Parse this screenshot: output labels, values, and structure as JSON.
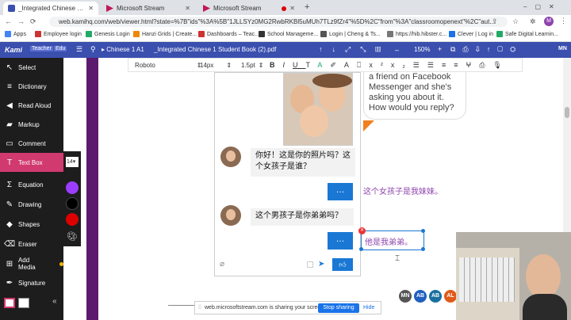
{
  "tabs": [
    {
      "title": "_Integrated Chinese 1 Student B",
      "active": true
    },
    {
      "title": "Microsoft Stream",
      "active": false
    },
    {
      "title": "Microsoft Stream",
      "active": false
    }
  ],
  "new_tab": "+",
  "address": {
    "url": "web.kamihq.com/web/viewer.html?state=%7B\"ids\"%3A%5B\"1JLLSYz0MG2RwbRKBl5uMUh7TLz9fZr4\"%5D%2C\"from\"%3A\"classroomopenext\"%2C\"aut..."
  },
  "profile_initial": "M",
  "bookmarks": [
    {
      "label": "Apps",
      "color": "#4285f4"
    },
    {
      "label": "Employee login",
      "color": "#c33"
    },
    {
      "label": "Genesis Login",
      "color": "#2a6"
    },
    {
      "label": "Hanzi Grids | Create...",
      "color": "#e80"
    },
    {
      "label": "Dashboards – Teac...",
      "color": "#c33"
    },
    {
      "label": "School Manageme...",
      "color": "#333"
    },
    {
      "label": "Login | Cheng & Ts...",
      "color": "#555"
    },
    {
      "label": "https://hib.hibster.c...",
      "color": "#777"
    },
    {
      "label": "Clever | Log in",
      "color": "#1a73e8"
    },
    {
      "label": "Safe Digital Learnin...",
      "color": "#2a6"
    }
  ],
  "kami": {
    "logo": "Kami",
    "role1": "Teacher",
    "role2": "Edu",
    "doc_breadcrumb": "Chinese 1 A1",
    "doc_name": "_Integrated Chinese 1 Student Book (2).pdf",
    "zoom": "150%",
    "avatar": "MN"
  },
  "tools": [
    {
      "label": "Select",
      "icon": "↖"
    },
    {
      "label": "Dictionary",
      "icon": "≡"
    },
    {
      "label": "Read Aloud",
      "icon": "◀"
    },
    {
      "label": "Markup",
      "icon": "▰"
    },
    {
      "label": "Comment",
      "icon": "▭"
    },
    {
      "label": "Text Box",
      "icon": "T"
    },
    {
      "label": "Equation",
      "icon": "Σ"
    },
    {
      "label": "Drawing",
      "icon": "✎"
    },
    {
      "label": "Shapes",
      "icon": "◆"
    },
    {
      "label": "Eraser",
      "icon": "⌫"
    },
    {
      "label": "Add Media",
      "icon": "⊞"
    },
    {
      "label": "Signature",
      "icon": "✒"
    }
  ],
  "text_size": "14",
  "swatches": [
    "#9b3dff",
    "#000000",
    "#dd0000"
  ],
  "format": {
    "font": "Roboto",
    "size": "14px",
    "line": "1.5pt"
  },
  "chat": {
    "q1": "你好！这是你的照片吗？这个女孩子是谁？",
    "q2": "这个男孩子是你弟弟吗？",
    "btn": "…",
    "a1": "这个女孩子是我妹妹。",
    "a2": "他是我弟弟。"
  },
  "speech": "a friend on Facebook Messenger and she's asking you about it. How would you reply?",
  "share": {
    "msg": "web.microsoftstream.com is sharing your screen.",
    "stop": "Stop sharing",
    "hide": "Hide"
  },
  "users": [
    {
      "initials": "MN",
      "color": "#555555"
    },
    {
      "initials": "AB",
      "color": "#1f5fbf"
    },
    {
      "initials": "AB",
      "color": "#1a6fa0"
    },
    {
      "initials": "AL",
      "color": "#e05a1a"
    }
  ]
}
